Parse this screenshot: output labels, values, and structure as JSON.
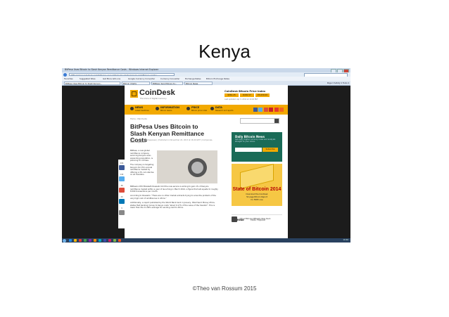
{
  "slide": {
    "title": "Kenya",
    "footer": "©Theo van Rossum 2015"
  },
  "browser": {
    "window_title": "BitPesa Uses Bitcoin to Slash Kenyan Remittance Costs - Windows Internet Explorer",
    "address": "http://www.coindesk.com/bitpesa-uses-bitcoin-to-slash-kenyan-remittance-costs/",
    "favorites": [
      "Favorites",
      "Suggested Sites",
      "Get More Add-ons",
      "Google Currency Converter",
      "Currency Converter",
      "Exchange Rates",
      "Bitcoin Exchange Rates"
    ],
    "tabs": [
      {
        "label": "BitPesa Uses Bitcoin to Slash Kenyan...",
        "active": true
      },
      {
        "label": "Bitcoin Charts",
        "active": false
      },
      {
        "label": "BitPesa: Send Money to...",
        "active": false
      },
      {
        "label": "Bitcoin News",
        "active": false
      }
    ],
    "commands": "Page ▾  Safety ▾  Tools ▾"
  },
  "site": {
    "logo": "CoinDesk",
    "tagline": "The Voice of Digital Currency",
    "bpi": {
      "title": "CoinDesk Bitcoin Price Index",
      "boxes": [
        "$581.25",
        "€430.57",
        "¥3,630.00"
      ],
      "updated": "Last updated: Apr 3, 2014 at 10:40 BST"
    },
    "nav": [
      {
        "label": "NEWS",
        "sub": "Latest headlines"
      },
      {
        "label": "INFORMATION",
        "sub": "Bitcoin basics"
      },
      {
        "label": "PRICE",
        "sub": "Bitcoin price index"
      },
      {
        "label": "DATA",
        "sub": "Research and reports"
      }
    ],
    "social_colors": [
      "#3b5998",
      "#55acee",
      "#dd4b39",
      "#cb2027",
      "#e5372b",
      "#f26522"
    ],
    "breadcrumb": "Home › Merchants",
    "search_placeholder": ""
  },
  "article": {
    "headline": "BitPesa Uses Bitcoin to Slash Kenyan Remittance Costs",
    "byline": "Emily Spaven (@emilyspaven) | Published on November 22, 2013 at 16:40 GMT | Companies, News, Regulation",
    "lead": [
      "BitPesa, a new global remittance company servicing Kenya's ever-expanding population, is planning to cut fees.",
      "The company is targeting Kenya's $1.17bn annual remittance market by offering a 3% cut-rate fee on all transfers."
    ],
    "body": [
      "BitPesa's CEO Elizabeth Rossiello told the new service is aiming to gain 1% of Kenya's remittance market within a year of launching in March 2014, a figure that will equate to roughly 8,500 transactions per month.",
      "According to Rossiello: \"There are no other market entrants trying to solve the problem of the very high cost of remittances in Africa.\"",
      "Additionally, a report published by the World Bank back in January, titled Send Money Africa, states that banking money to Kenya costs \"about 9.17% of the value of the transfer\". This is lower than the 11.09% average for sending cash to Africa."
    ],
    "share_counts": [
      "206",
      "140",
      "38",
      "20",
      "9"
    ]
  },
  "sidebar": {
    "newsletter": {
      "title": "Daily Bitcoin News",
      "text": "Get daily digital currency news and analysis straight to your inbox.",
      "button": "Subscribe"
    },
    "ad": {
      "title": "State of Bitcoin 2014",
      "lines": [
        "Download the CoinDesk",
        "54 page Bitcoin Report",
        "for FREE now"
      ]
    },
    "hot_tabs": [
      "Hot Read",
      "Most Popular"
    ],
    "hot_item": "CEO of Bitcoin Officially Now Deck"
  },
  "taskbar": {
    "icon_colors": [
      "#1e88e5",
      "#f4b400",
      "#e53935",
      "#43a047",
      "#8e24aa",
      "#fb8c00",
      "#00acc1",
      "#3949ab",
      "#d81b60",
      "#7cb342",
      "#f4511e"
    ],
    "clock": "10:40"
  }
}
